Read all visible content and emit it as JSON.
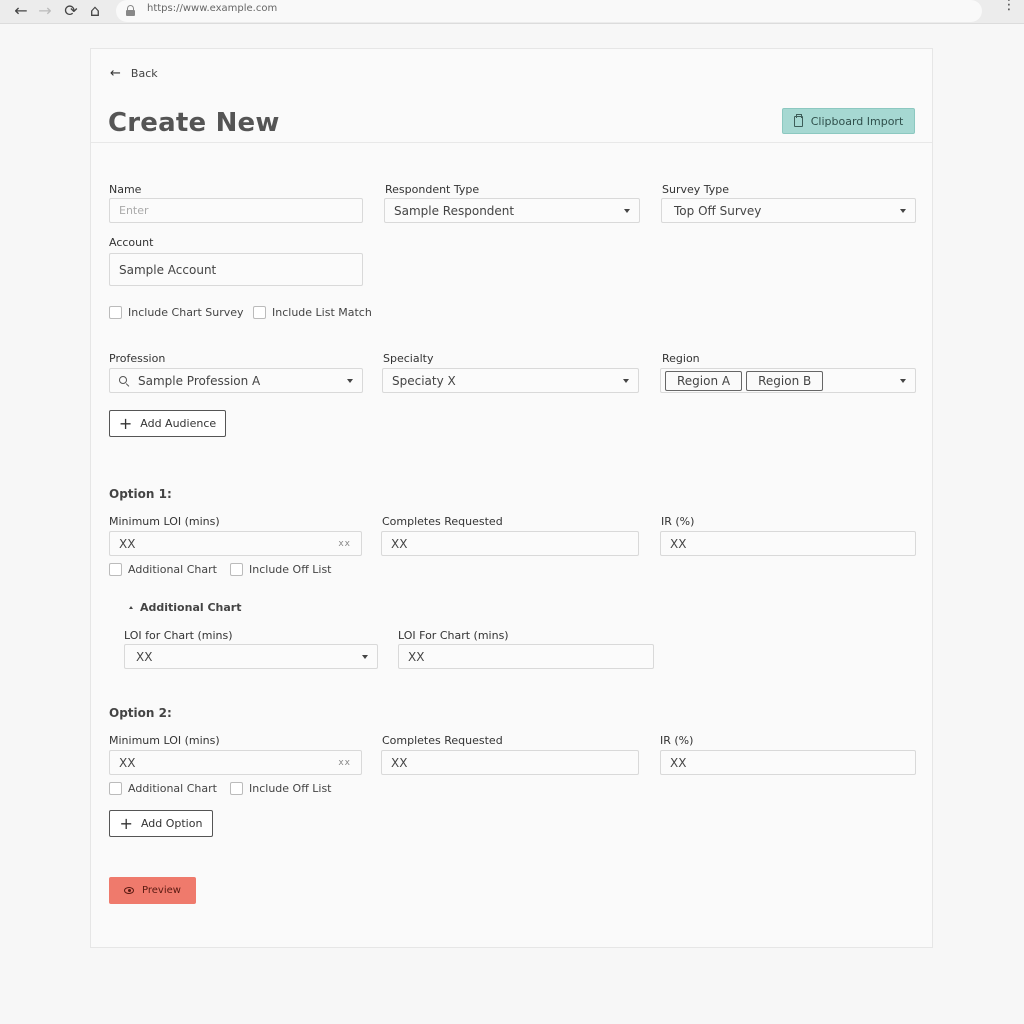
{
  "browser": {
    "url": "https://www.example.com"
  },
  "header": {
    "back_label": "Back",
    "title": "Create New",
    "clipboard_import_label": "Clipboard Import"
  },
  "form": {
    "name": {
      "label": "Name",
      "placeholder": "Enter",
      "value": ""
    },
    "respondent_type": {
      "label": "Respondent Type",
      "value": "Sample Respondent"
    },
    "survey_type": {
      "label": "Survey Type",
      "value": "Top Off Survey"
    },
    "account": {
      "label": "Account",
      "value": "Sample Account"
    },
    "include_chart_survey": {
      "label": "Include Chart Survey",
      "checked": false
    },
    "include_list_match": {
      "label": "Include List Match",
      "checked": false
    },
    "profession": {
      "label": "Profession",
      "value": "Sample Profession A"
    },
    "specialty": {
      "label": "Specialty",
      "value": "Speciaty X"
    },
    "region": {
      "label": "Region",
      "chips": [
        "Region A",
        "Region B"
      ]
    },
    "add_audience_label": "Add Audience"
  },
  "options": [
    {
      "title": "Option 1:",
      "min_loi": {
        "label": "Minimum LOI (mins)",
        "value": "XX",
        "suffix": "xx"
      },
      "completes": {
        "label": "Completes Requested",
        "value": "XX"
      },
      "ir": {
        "label": "IR (%)",
        "value": "XX"
      },
      "additional_chart": {
        "label": "Additional Chart",
        "checked": false
      },
      "include_off_list": {
        "label": "Include Off List",
        "checked": false
      },
      "additional_chart_section": {
        "title": "Additional Chart",
        "loi_chart_select": {
          "label": "LOI for Chart (mins)",
          "value": "XX"
        },
        "loi_chart_input": {
          "label": "LOI For Chart (mins)",
          "value": "XX"
        }
      }
    },
    {
      "title": "Option 2:",
      "min_loi": {
        "label": "Minimum LOI (mins)",
        "value": "XX",
        "suffix": "xx"
      },
      "completes": {
        "label": "Completes Requested",
        "value": "XX"
      },
      "ir": {
        "label": "IR (%)",
        "value": "XX"
      },
      "additional_chart": {
        "label": "Additional Chart",
        "checked": false
      },
      "include_off_list": {
        "label": "Include Off List",
        "checked": false
      }
    }
  ],
  "add_option_label": "Add Option",
  "preview_label": "Preview",
  "icons": {
    "back": "arrow-left-icon",
    "forward": "arrow-right-icon",
    "reload": "reload-icon",
    "home": "home-icon",
    "lock": "lock-icon",
    "menu": "kebab-menu-icon",
    "clipboard": "clipboard-icon",
    "search": "search-icon",
    "plus": "plus-icon",
    "eye": "eye-icon"
  },
  "colors": {
    "clipboard_button": "#a6d8d2",
    "preview_button": "#ef7a6c"
  }
}
